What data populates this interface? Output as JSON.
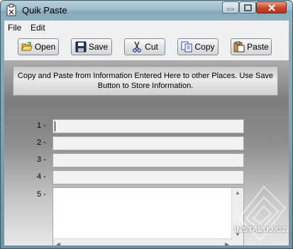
{
  "window": {
    "title": "Quik Paste"
  },
  "menu": {
    "items": [
      "File",
      "Edit"
    ]
  },
  "toolbar": {
    "buttons": [
      {
        "label": "Open",
        "icon": "folder-open-icon"
      },
      {
        "label": "Save",
        "icon": "floppy-disk-icon"
      },
      {
        "label": "Cut",
        "icon": "scissors-icon"
      },
      {
        "label": "Copy",
        "icon": "copy-icon"
      },
      {
        "label": "Paste",
        "icon": "paste-icon"
      }
    ]
  },
  "banner": {
    "text": "Copy and Paste from Information Entered Here to other Places. Use Save Button to Store Information."
  },
  "fields": [
    {
      "label": "1 -",
      "value": ""
    },
    {
      "label": "2 -",
      "value": ""
    },
    {
      "label": "3 -",
      "value": ""
    },
    {
      "label": "4 -",
      "value": ""
    },
    {
      "label": "5 -",
      "value": ""
    }
  ],
  "watermark": {
    "text": "INSTALUJ.CZ"
  }
}
